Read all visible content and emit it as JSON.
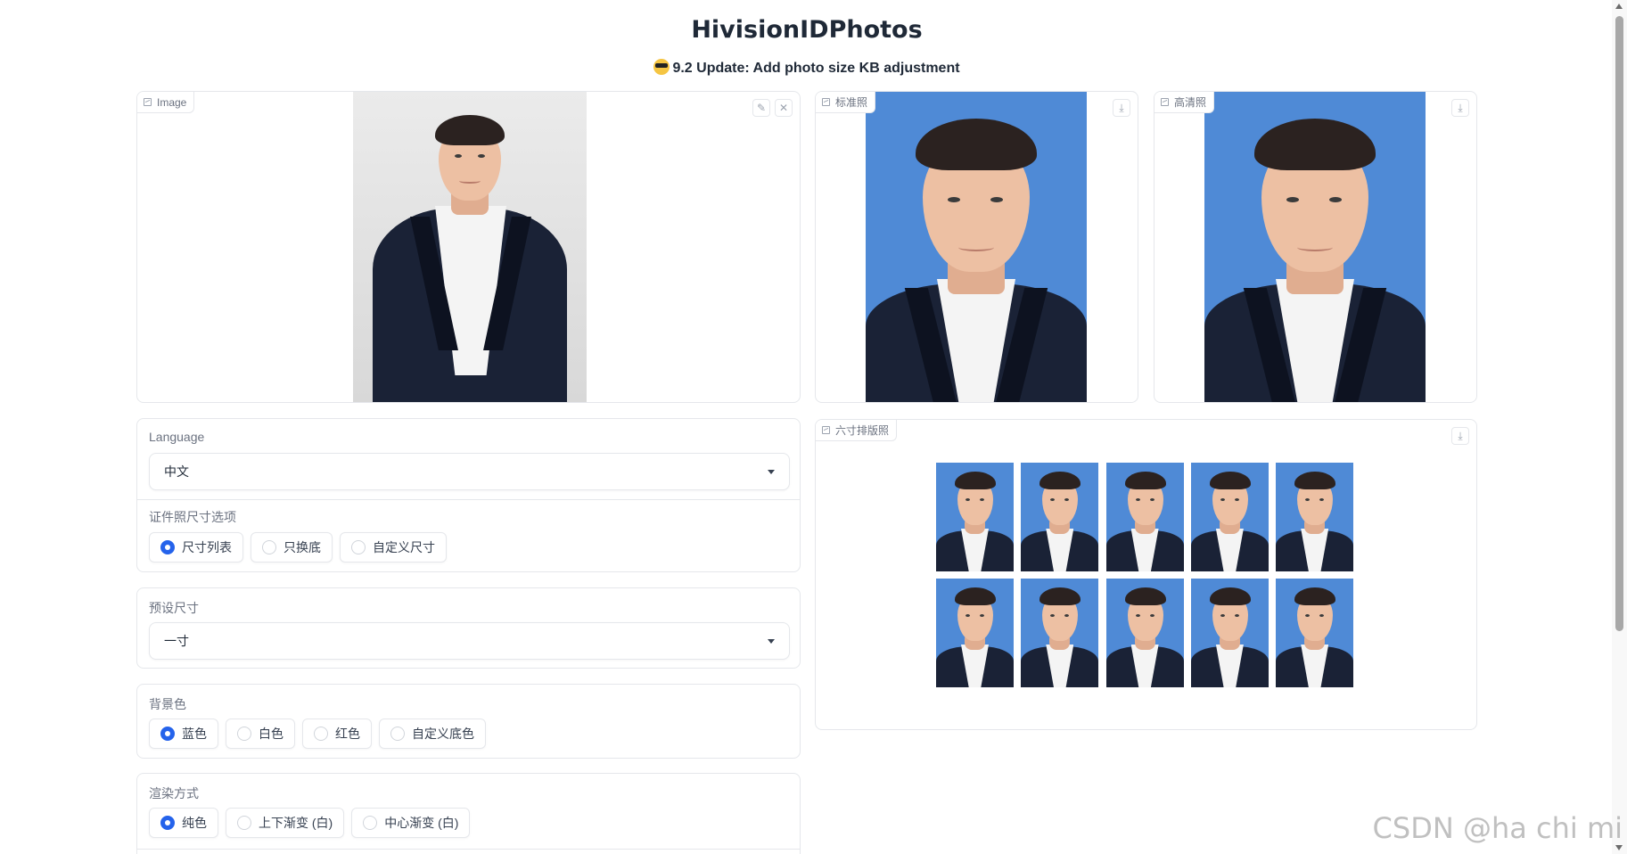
{
  "page": {
    "title": "HivisionIDPhotos",
    "subtitle": "9.2 Update: Add photo size KB adjustment",
    "subtitle_emoji": "sunglasses-emoji"
  },
  "input_image": {
    "label": "Image",
    "edit_icon": "pencil-icon",
    "clear_icon": "close-icon",
    "photo_bg": "#e6e6e6"
  },
  "standard_photo": {
    "label": "标准照",
    "download_icon": "download-icon",
    "bg": "#4f8ad6"
  },
  "hd_photo": {
    "label": "高清照",
    "download_icon": "download-icon",
    "bg": "#4f8ad6"
  },
  "layout_photo": {
    "label": "六寸排版照",
    "download_icon": "download-icon",
    "rows": 2,
    "cols": 5,
    "bg": "#4f8ad6"
  },
  "language": {
    "label": "Language",
    "value": "中文"
  },
  "size_option": {
    "label": "证件照尺寸选项",
    "options": [
      "尺寸列表",
      "只换底",
      "自定义尺寸"
    ],
    "selected": "尺寸列表"
  },
  "preset_size": {
    "label": "预设尺寸",
    "value": "一寸"
  },
  "background_color": {
    "label": "背景色",
    "options": [
      "蓝色",
      "白色",
      "红色",
      "自定义底色"
    ],
    "selected": "蓝色"
  },
  "render_mode": {
    "label": "渲染方式",
    "options": [
      "纯色",
      "上下渐变 (白)",
      "中心渐变 (白)"
    ],
    "selected": "纯色"
  },
  "watermark": "CSDN @ha chi mi"
}
